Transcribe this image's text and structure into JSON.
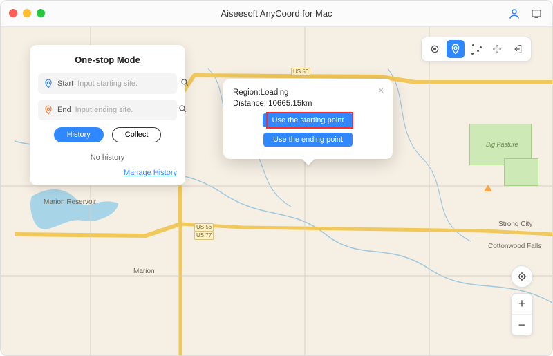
{
  "title": "Aiseesoft AnyCoord for Mac",
  "panel": {
    "heading": "One-stop Mode",
    "start_label": "Start",
    "start_placeholder": "Input starting site.",
    "end_label": "End",
    "end_placeholder": "Input ending site.",
    "history_btn": "History",
    "collect_btn": "Collect",
    "no_history": "No history",
    "manage_link": "Manage History"
  },
  "popup": {
    "region_line": "Region:Loading",
    "distance_line": "Distance: 10665.15km",
    "use_start": "Use the starting point",
    "use_end": "Use the ending point"
  },
  "map": {
    "reservoir": "Marion Reservoir",
    "city_marion": "Marion",
    "city_strong": "Strong City",
    "city_cottonwood": "Cottonwood Falls",
    "park_label": "Big Pasture",
    "road_us56": "US 56",
    "road_us77": "US 77"
  },
  "zoom": {
    "plus": "+",
    "minus": "−"
  }
}
